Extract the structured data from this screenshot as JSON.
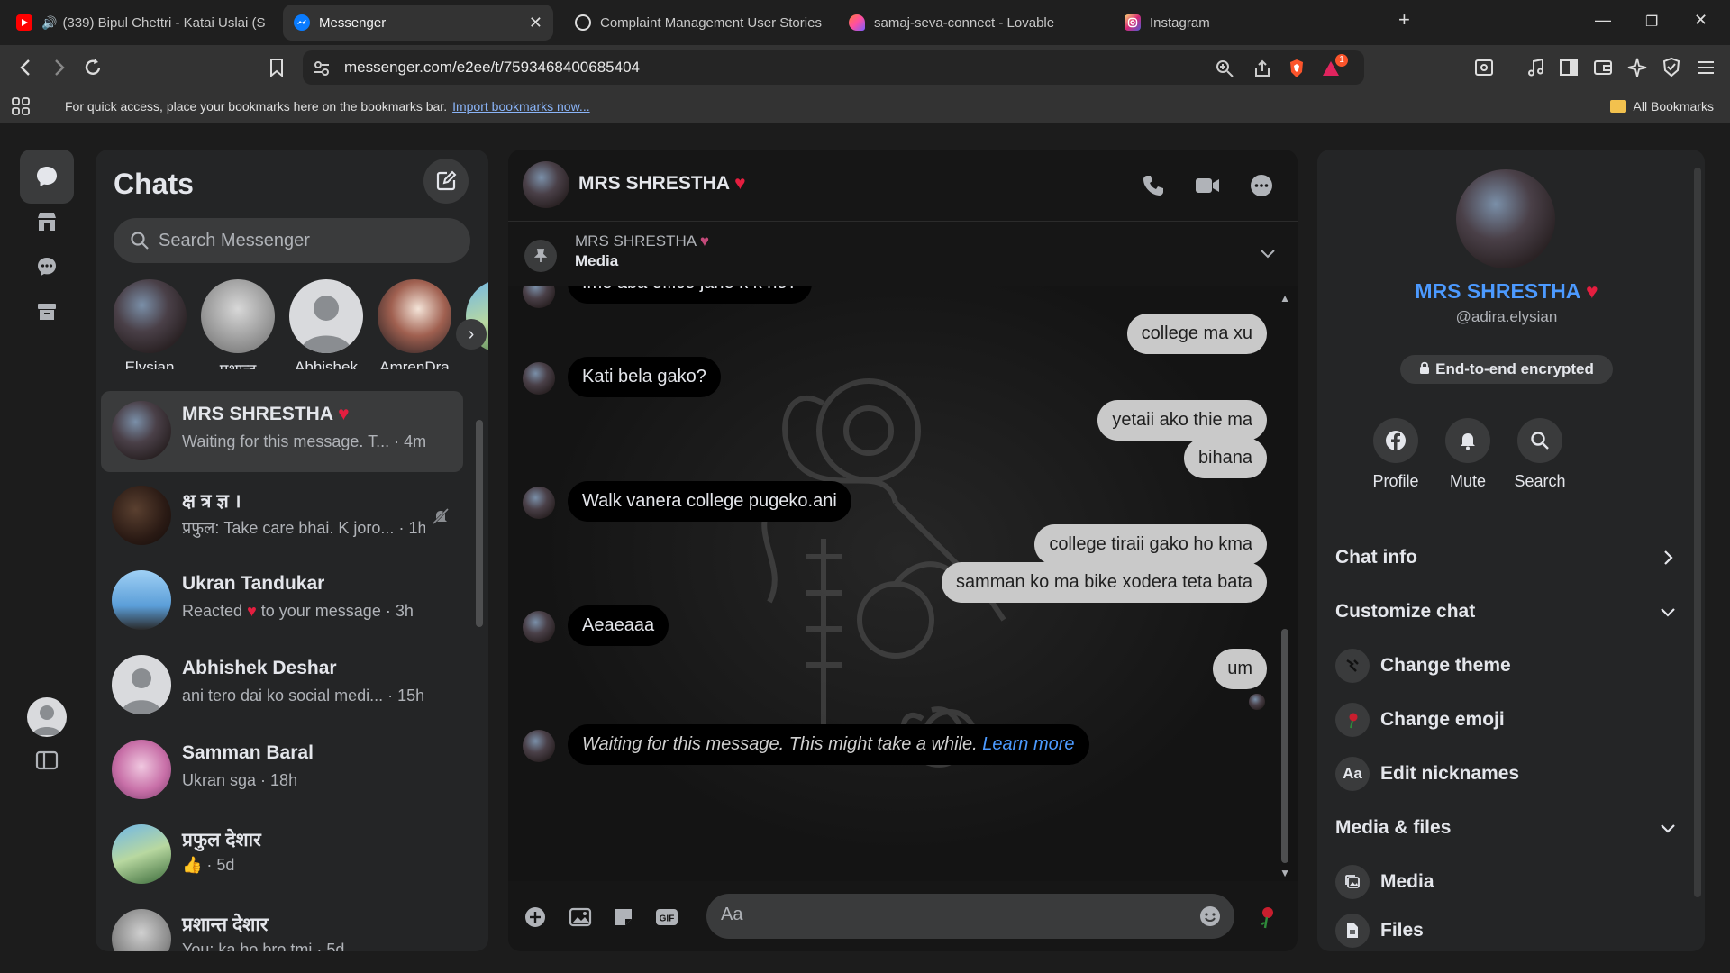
{
  "browser": {
    "tabs": [
      {
        "title": "(339) Bipul Chettri - Katai Uslai (S",
        "icon": "youtube-icon",
        "color": "#ff0000",
        "audio": true
      },
      {
        "title": "Messenger",
        "icon": "messenger-icon",
        "color": "#0a7cff",
        "active": true
      },
      {
        "title": "Complaint Management User Stories",
        "icon": "openai-icon",
        "color": "#ffffff"
      },
      {
        "title": "samaj-seva-connect - Lovable",
        "icon": "lovable-icon",
        "color": "#ff4fa0"
      },
      {
        "title": "Instagram",
        "icon": "instagram-icon",
        "color": "#e1306c"
      }
    ],
    "url": "messenger.com/e2ee/t/7593468400685404",
    "notification_count": "1",
    "bookmarks_message": "For quick access, place your bookmarks here on the bookmarks bar.",
    "bookmarks_link": "Import bookmarks now...",
    "all_bookmarks": "All Bookmarks"
  },
  "chatlist": {
    "title": "Chats",
    "search_placeholder": "Search Messenger",
    "stories": [
      {
        "name": "Elysian"
      },
      {
        "name": "प्रशान्त"
      },
      {
        "name": "Abhishek"
      },
      {
        "name": "AmrenDra"
      }
    ],
    "conversations": [
      {
        "name": "MRS SHRESTHA",
        "heart": true,
        "preview": "Waiting for this message. T...",
        "time": "4m",
        "active": true
      },
      {
        "name": "क्ष त्र ज्ञ ।",
        "preview": "प्रफुल: Take care bhai. K joro...",
        "time": "1h",
        "muted": true
      },
      {
        "name": "Ukran Tandukar",
        "preview": "Reacted",
        "preview_suffix": "to your message",
        "time": "3h"
      },
      {
        "name": "Abhishek Deshar",
        "preview": "ani tero dai ko social medi...",
        "time": "15h"
      },
      {
        "name": "Samman Baral",
        "preview": "Ukran sga",
        "time": "18h"
      },
      {
        "name": "प्रफुल देशार",
        "preview": "",
        "time": "5d"
      },
      {
        "name": "प्रशान्त देशार",
        "preview": "You: ka ho bro tmi",
        "time": "5d"
      }
    ]
  },
  "chat": {
    "name": "MRS SHRESTHA",
    "pinned_name": "MRS SHRESTHA",
    "pinned_label": "Media",
    "messages": [
      {
        "type": "in",
        "text": "Ime aba office jane k k ho?"
      },
      {
        "type": "out",
        "text": "college ma xu"
      },
      {
        "type": "in",
        "text": "Kati bela gako?"
      },
      {
        "type": "out",
        "text": "yetaii ako thie ma"
      },
      {
        "type": "out",
        "text": "bihana"
      },
      {
        "type": "in",
        "text": "Walk vanera college pugeko.ani"
      },
      {
        "type": "out",
        "text": "college tiraii gako ho kma"
      },
      {
        "type": "out",
        "text": "samman ko ma bike xodera teta bata"
      },
      {
        "type": "in",
        "text": "Aeaeaaa"
      },
      {
        "type": "out",
        "text": "um"
      }
    ],
    "waiting_text": "Waiting for this message. This might take a while.",
    "learn_more": "Learn more",
    "input_placeholder": "Aa"
  },
  "info": {
    "name": "MRS SHRESTHA",
    "handle": "@adira.elysian",
    "e2e": "End-to-end encrypted",
    "actions": [
      {
        "label": "Profile",
        "icon": "facebook-icon"
      },
      {
        "label": "Mute",
        "icon": "bell-icon"
      },
      {
        "label": "Search",
        "icon": "search-icon"
      }
    ],
    "chat_info": "Chat info",
    "customize_chat": "Customize chat",
    "change_theme": "Change theme",
    "change_emoji": "Change emoji",
    "edit_nicknames": "Edit nicknames",
    "nicknames_icon_text": "Aa",
    "media_files": "Media & files",
    "media": "Media",
    "files": "Files"
  },
  "colors": {
    "accent": "#4c9aff",
    "heart": "#e41e3f"
  }
}
